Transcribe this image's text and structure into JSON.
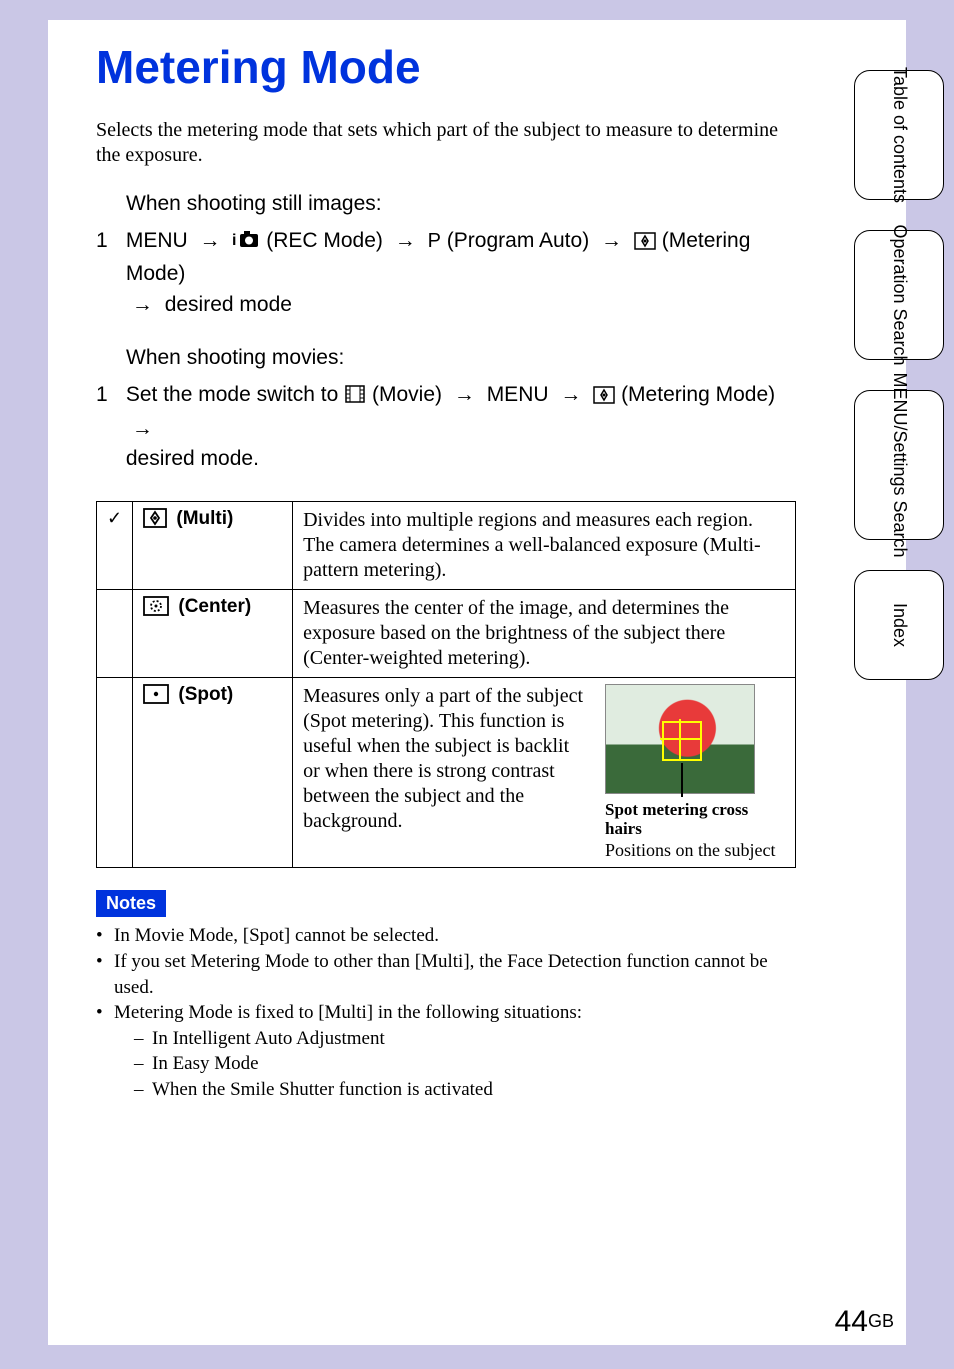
{
  "title": "Metering Mode",
  "intro": "Selects the metering mode that sets which part of the subject to measure to determine the exposure.",
  "stills": {
    "heading": "When shooting still images:",
    "step_num": "1",
    "menu": "MENU",
    "rec_mode": "(REC Mode)",
    "p_letter": "P",
    "prog_auto": "(Program Auto)",
    "metering_mode": "(Metering Mode)",
    "desired": "desired mode"
  },
  "movies": {
    "heading": "When shooting movies:",
    "step_num": "1",
    "set_switch": "Set the mode switch to",
    "movie": "(Movie)",
    "menu": "MENU",
    "metering_mode": "(Metering Mode)",
    "desired": "desired mode."
  },
  "table": {
    "check": "✓",
    "multi": {
      "name": "(Multi)",
      "desc": "Divides into multiple regions and measures each region. The camera determines a well-balanced exposure (Multi-pattern metering)."
    },
    "center": {
      "name": "(Center)",
      "desc": "Measures the center of the image, and determines the exposure based on the brightness of the subject there (Center-weighted metering)."
    },
    "spot": {
      "name": "(Spot)",
      "desc": "Measures only a part of the subject (Spot metering). This function is useful when the subject is backlit or when there is strong contrast between the subject and the background.",
      "fig_label1": "Spot metering cross hairs",
      "fig_label2": "Positions on the subject"
    }
  },
  "notes": {
    "heading": "Notes",
    "n1": "In Movie Mode, [Spot] cannot be selected.",
    "n2": "If you set Metering Mode to other than [Multi], the Face Detection function cannot be used.",
    "n3": "Metering Mode is fixed to [Multi] in the following situations:",
    "s1": "In Intelligent Auto Adjustment",
    "s2": "In Easy Mode",
    "s3": "When the Smile Shutter function is activated"
  },
  "tabs": {
    "t1": "Table of contents",
    "t2": "Operation Search",
    "t3": "MENU/Settings Search",
    "t4": "Index"
  },
  "page": {
    "num": "44",
    "suffix": "GB"
  },
  "arrow_char": "→"
}
